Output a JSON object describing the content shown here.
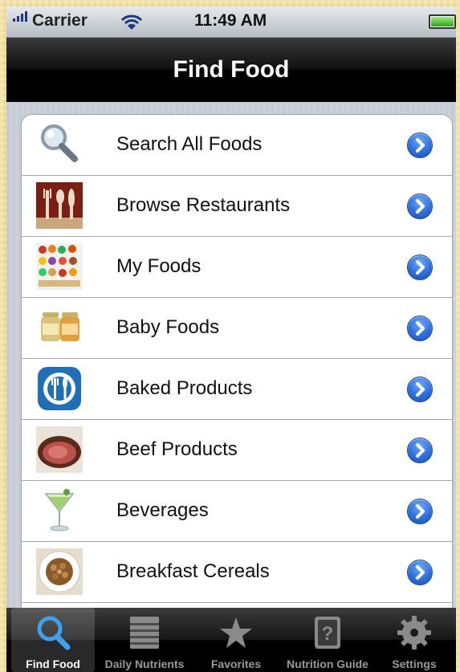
{
  "status_bar": {
    "carrier": "Carrier",
    "time": "11:49 AM"
  },
  "nav": {
    "title": "Find Food"
  },
  "rows": [
    {
      "label": "Search All Foods",
      "icon": "magnifier-icon"
    },
    {
      "label": "Browse Restaurants",
      "icon": "restaurant-cutlery-icon"
    },
    {
      "label": "My Foods",
      "icon": "food-grid-icon"
    },
    {
      "label": "Baby Foods",
      "icon": "baby-food-jars-icon"
    },
    {
      "label": "Baked Products",
      "icon": "plate-utensils-icon"
    },
    {
      "label": "Beef Products",
      "icon": "roast-beef-icon"
    },
    {
      "label": "Beverages",
      "icon": "cocktail-glass-icon"
    },
    {
      "label": "Breakfast Cereals",
      "icon": "cereal-bowl-icon"
    }
  ],
  "tabs": [
    {
      "label": "Find Food",
      "icon": "magnifier-icon",
      "selected": true
    },
    {
      "label": "Daily Nutrients",
      "icon": "ledger-icon",
      "selected": false
    },
    {
      "label": "Favorites",
      "icon": "star-icon",
      "selected": false
    },
    {
      "label": "Nutrition Guide",
      "icon": "question-book-icon",
      "selected": false
    },
    {
      "label": "Settings",
      "icon": "gear-icon",
      "selected": false
    }
  ],
  "colors": {
    "accent_blue": "#2f6fdc",
    "selected_tab_text": "#ffffff",
    "unselected_tab_text": "#9a9a9a"
  }
}
